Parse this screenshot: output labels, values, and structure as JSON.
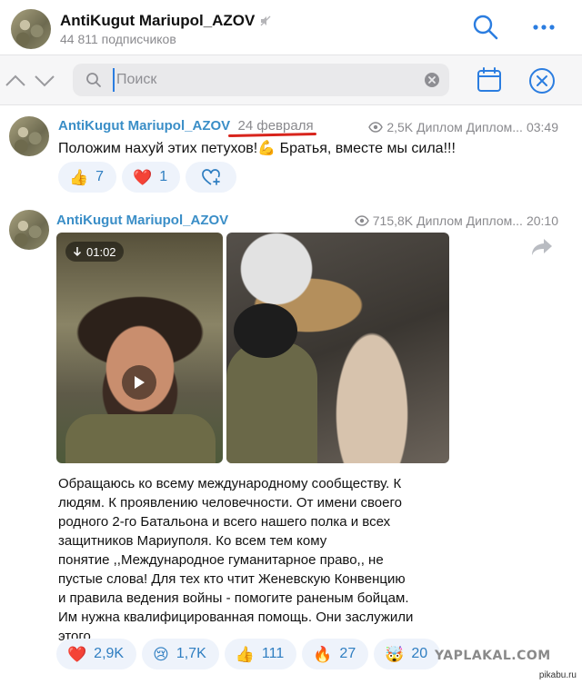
{
  "header": {
    "title": "AntiKugut Mariupol_AZOV",
    "subtitle": "44 811 подписчиков"
  },
  "search": {
    "placeholder": "Поиск"
  },
  "posts": [
    {
      "author": "AntiKugut Mariupol_AZOV",
      "date": "24 февраля",
      "views": "2,5K",
      "signature": "Диплом Диплом...",
      "time": "03:49",
      "text": "Положим нахуй этих петухов!💪 Братья, вместе мы сила!!!",
      "reactions": [
        {
          "emoji": "👍",
          "count": "7"
        },
        {
          "emoji": "❤️",
          "count": "1"
        }
      ]
    },
    {
      "author": "AntiKugut Mariupol_AZOV",
      "views": "715,8K",
      "signature": "Диплом Диплом...",
      "time": "20:10",
      "video_duration": "01:02",
      "text_lines": [
        "Обращаюсь ко всему международному сообществу. К",
        "людям. К проявлению человечности. От имени своего",
        "родного 2-го Батальона и всего нашего полка и всех",
        "защитников Мариуполя. Ко всем тем кому",
        "понятие ,,Международное гуманитарное право,, не",
        "пустые слова! Для тех кто чтит Женевскую Конвенцию",
        "и правила ведения войны - помогите раненым бойцам.",
        "Им нужна квалифицированная помощь. Они заслужили",
        "этого."
      ],
      "reactions": [
        {
          "emoji": "❤️",
          "count": "2,9K"
        },
        {
          "emoji": "😢",
          "count": "1,7K"
        },
        {
          "emoji": "👍",
          "count": "111"
        },
        {
          "emoji": "🔥",
          "count": "27"
        },
        {
          "emoji": "🤯",
          "count": "20"
        }
      ]
    }
  ],
  "watermark": "YAPLAKAL.COM",
  "source_credit": "pikabu.ru",
  "colors": {
    "accent": "#3a8ec7",
    "link": "#2b7de0",
    "reaction_bg": "#eef3fb",
    "underline_red": "#d8241c"
  },
  "icons": {
    "header_search": "search-icon",
    "header_more": "more-icon",
    "nav_up": "chevron-up-icon",
    "nav_down": "chevron-down-icon",
    "calendar": "calendar-icon",
    "close": "close-circle-icon",
    "share": "share-icon",
    "views": "eye-icon",
    "add_reaction": "add-reaction-icon",
    "muted": "muted-icon"
  }
}
